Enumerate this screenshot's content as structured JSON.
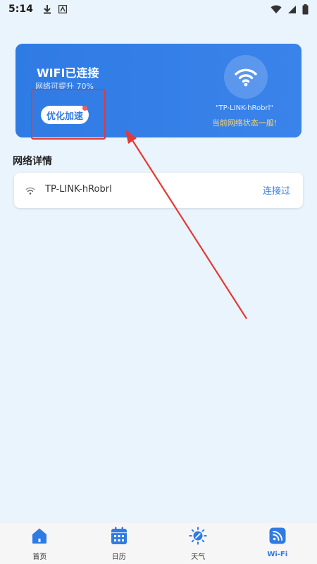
{
  "status_bar": {
    "time": "5:14",
    "icons": [
      "download-icon",
      "notification-a-icon",
      "wifi-icon",
      "signal-icon",
      "battery-icon"
    ]
  },
  "wifi_card": {
    "title": "WIFI已连接",
    "subtitle": "网络可提升 70%",
    "optimize_label": "优化加速",
    "ssid": "\"TP-LINK-hRobrl\"",
    "status_message": "当前网络状态一般!",
    "colors": {
      "card": "#2f7be4",
      "message": "#ffd76a",
      "badge": "#f15a5a"
    }
  },
  "network_details": {
    "title": "网络详情",
    "items": [
      {
        "name": "TP-LINK-hRobrl",
        "status": "连接过"
      }
    ]
  },
  "bottom_nav": {
    "tabs": [
      {
        "label": "首页",
        "icon": "home-icon",
        "active": false
      },
      {
        "label": "日历",
        "icon": "calendar-icon",
        "active": false
      },
      {
        "label": "天气",
        "icon": "weather-icon",
        "active": false
      },
      {
        "label": "Wi-Fi",
        "icon": "wifi-icon",
        "active": true
      }
    ]
  },
  "colors": {
    "accent": "#2f7be4",
    "background": "#e9f4fc",
    "annotation": "#e53935"
  }
}
